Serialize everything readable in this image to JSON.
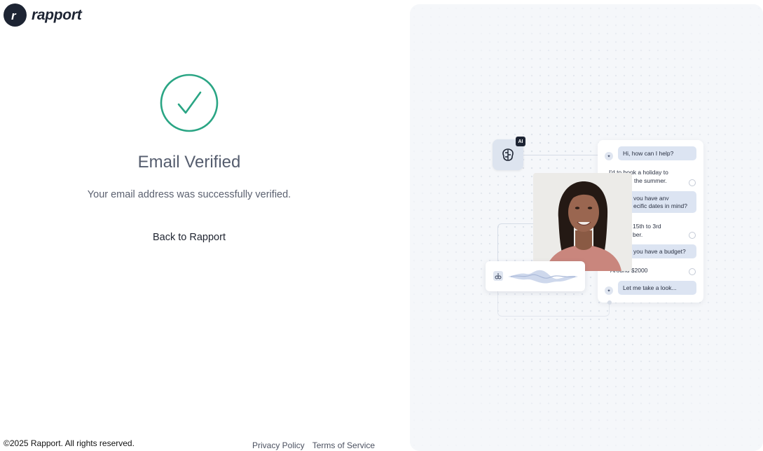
{
  "brand": {
    "name": "rapport",
    "logo_letter": "r",
    "color": "#1d2433"
  },
  "verification": {
    "icon": "check-circle-icon",
    "accent_color": "#2aa584",
    "title": "Email Verified",
    "message": "Your email address was successfully verified.",
    "back_link": "Back to Rapport"
  },
  "footer": {
    "copyright": "©2025 Rapport. All rights reserved.",
    "privacy": "Privacy Policy",
    "terms": "Terms of Service"
  },
  "illustration": {
    "ai_badge": "AI",
    "chat": [
      {
        "role": "bot",
        "text": "Hi, how can I help?"
      },
      {
        "role": "user",
        "text": "I'd to book a holiday to"
      },
      {
        "role": "user",
        "text": "the summer."
      },
      {
        "role": "bot",
        "text": "you have any"
      },
      {
        "role": "bot",
        "text": "ecific dates in mind?"
      },
      {
        "role": "user",
        "text": "15th to 3rd"
      },
      {
        "role": "user",
        "text": "ber."
      },
      {
        "role": "bot",
        "text": "you have a budget?"
      },
      {
        "role": "user",
        "text": "Around $2000"
      },
      {
        "role": "bot",
        "text": "Let me take a look..."
      }
    ]
  }
}
